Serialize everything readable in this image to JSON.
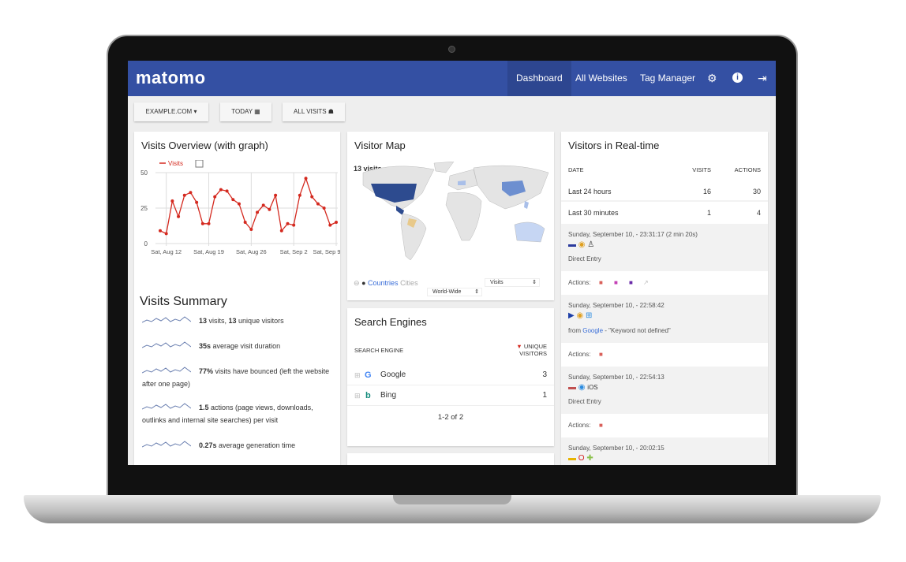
{
  "header": {
    "logo": "matomo",
    "nav": [
      "Dashboard",
      "All Websites",
      "Tag Manager"
    ],
    "icons": [
      "gear-icon",
      "info-icon",
      "logout-icon"
    ]
  },
  "toolbar": {
    "site": "EXAMPLE.COM",
    "site_icon": "caret-down-icon",
    "period": "TODAY",
    "period_icon": "calendar-icon",
    "segment": "ALL VISITS",
    "segment_icon": "segment-icon"
  },
  "visits_overview": {
    "title": "Visits Overview (with graph)",
    "chart_data": {
      "type": "line",
      "legend": "Visits",
      "color": "#d4291f",
      "ylim": [
        0,
        50
      ],
      "yticks": [
        0,
        25,
        50
      ],
      "xtick_labels": [
        "Sat, Aug 12",
        "Sat, Aug 19",
        "Sat, Aug 26",
        "Sat, Sep 2",
        "Sat, Sep 9"
      ],
      "grid": true,
      "legend_position": "top-left",
      "x": [
        "Aug 11",
        "Aug 12",
        "Aug 13",
        "Aug 14",
        "Aug 15",
        "Aug 16",
        "Aug 17",
        "Aug 18",
        "Aug 19",
        "Aug 20",
        "Aug 21",
        "Aug 22",
        "Aug 23",
        "Aug 24",
        "Aug 25",
        "Aug 26",
        "Aug 27",
        "Aug 28",
        "Aug 29",
        "Aug 30",
        "Aug 31",
        "Sep 1",
        "Sep 2",
        "Sep 3",
        "Sep 4",
        "Sep 5",
        "Sep 6",
        "Sep 7",
        "Sep 8",
        "Sep 9"
      ],
      "values": [
        9,
        7,
        30,
        19,
        34,
        36,
        29,
        14,
        14,
        33,
        38,
        37,
        31,
        28,
        15,
        10,
        22,
        27,
        24,
        34,
        9,
        14,
        13,
        34,
        46,
        33,
        28,
        25,
        13,
        15
      ]
    }
  },
  "visits_summary": {
    "title": "Visits Summary",
    "items": [
      {
        "bold": "13",
        "text": " visits, ",
        "bold2": "13",
        "text2": " unique visitors"
      },
      {
        "bold": "35s",
        "text": " average visit duration"
      },
      {
        "bold": "77%",
        "text": " visits have bounced (left the website after one page)"
      },
      {
        "bold": "1.5",
        "text": " actions (page views, downloads, outlinks and internal site searches) per visit"
      },
      {
        "bold": "0.27s",
        "text": " average generation time"
      }
    ]
  },
  "visitor_map": {
    "title": "Visitor Map",
    "visits": "13 visits",
    "countries": "Countries",
    "cities": "Cities",
    "metric": "Visits",
    "region": "World-Wide"
  },
  "search_engines": {
    "title": "Search Engines",
    "col1": "SEARCH ENGINE",
    "col2a": "UNIQUE",
    "col2b": "VISITORS",
    "rows": [
      {
        "name": "Google",
        "value": "3"
      },
      {
        "name": "Bing",
        "value": "1"
      }
    ],
    "pagination": "1-2 of 2"
  },
  "realtime": {
    "title": "Visitors in Real-time",
    "cols": [
      "DATE",
      "VISITS",
      "ACTIONS"
    ],
    "rows": [
      {
        "label": "Last 24 hours",
        "visits": "16",
        "actions": "30"
      },
      {
        "label": "Last 30 minutes",
        "visits": "1",
        "actions": "4"
      }
    ],
    "actions_label": "Actions:",
    "visits": [
      {
        "time": "Sunday, September 10, - 23:31:17 (2 min 20s)",
        "source": "Direct Entry"
      },
      {
        "time": "Sunday, September 10, - 22:58:42",
        "source_prefix": "from ",
        "source_link": "Google",
        "source_suffix": " - \"Keyword not defined\""
      },
      {
        "time": "Sunday, September 10, - 22:54:13",
        "os": "iOS",
        "source": "Direct Entry"
      },
      {
        "time": "Sunday, September 10, - 20:02:15"
      }
    ]
  }
}
